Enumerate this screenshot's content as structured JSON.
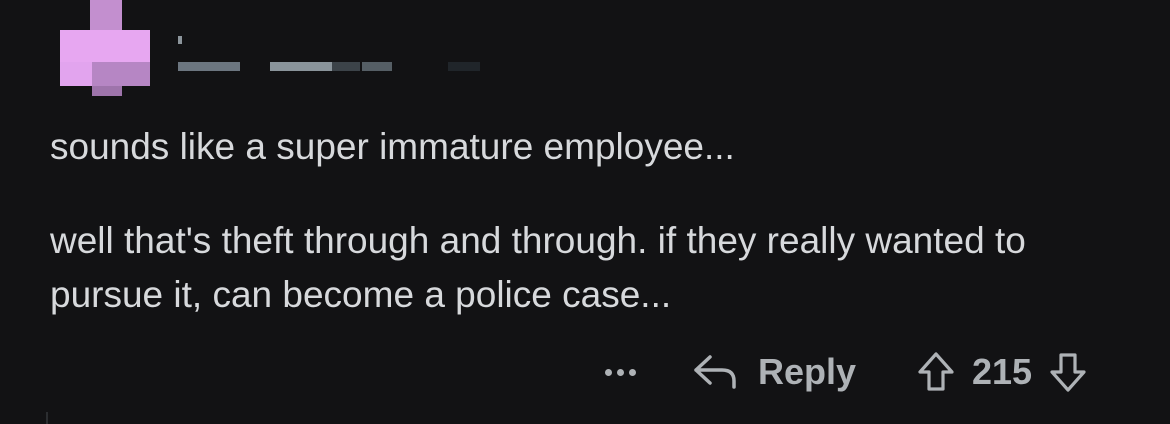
{
  "comment": {
    "paragraphs": [
      "sounds like a super immature employee...",
      "well that's theft through and through. if they really wanted to pursue it, can become a police case..."
    ]
  },
  "actions": {
    "more_icon": "ellipsis-icon",
    "reply_label": "Reply",
    "reply_icon": "reply-arrow-icon",
    "upvote_icon": "arrow-up-icon",
    "score": "215",
    "downvote_icon": "arrow-down-icon"
  },
  "colors": {
    "background": "#121214",
    "text": "#d7d9dc",
    "muted": "#aeb2b6",
    "avatar": "#e7a7f1"
  }
}
